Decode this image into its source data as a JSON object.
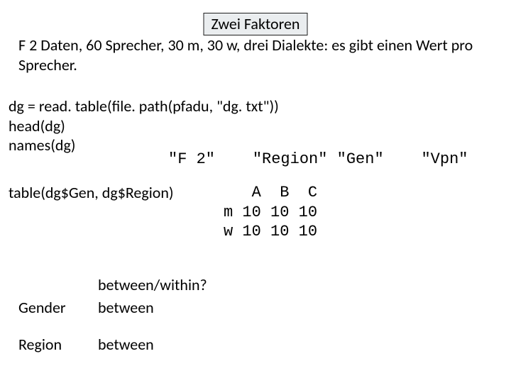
{
  "title": "Zwei Faktoren",
  "description": "F 2 Daten, 60 Sprecher, 30 m, 30 w, drei Dialekte: es gibt einen Wert pro Sprecher.",
  "code": {
    "l1": "dg = read. table(file. path(pfadu, \"dg. txt\"))",
    "l2": "head(dg)",
    "l3": "names(dg)"
  },
  "names_out": "\"F 2\"    \"Region\" \"Gen\"    \"Vpn\"",
  "tbl": {
    "call": "table(dg$Gen, dg$Region)",
    "out": "   A  B  C\nm 10 10 10\nw 10 10 10"
  },
  "bw": {
    "header": "between/within?",
    "gender_label": "Gender",
    "gender_answer": "between",
    "region_label": "Region",
    "region_answer": "between"
  }
}
